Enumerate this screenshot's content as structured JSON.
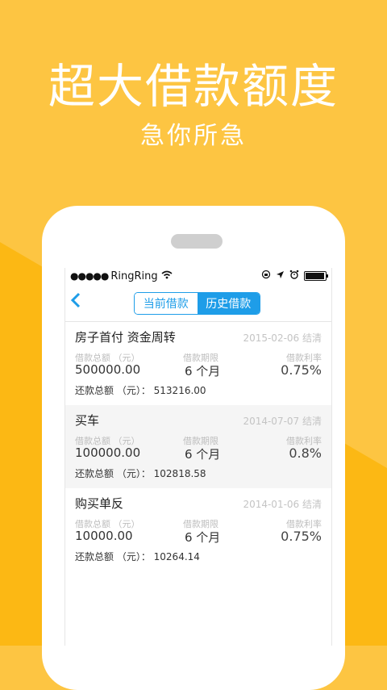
{
  "promo": {
    "headline": "超大借款额度",
    "subheadline": "急你所急"
  },
  "status_bar": {
    "signal": "●●●●●",
    "carrier": "RingRing",
    "battery_fraction": 0.9
  },
  "nav": {
    "tabs": [
      {
        "label": "当前借款",
        "active": false
      },
      {
        "label": "历史借款",
        "active": true
      }
    ]
  },
  "loans": [
    {
      "name": "房子首付 资金周转",
      "date_status": "2015-02-06 结清",
      "amount_label": "借款总额 （元）",
      "amount": "500000.00",
      "term_label": "借款期限",
      "term": "6 个月",
      "rate_label": "借款利率",
      "rate": "0.75%",
      "repay_label": "还款总额 （元）：",
      "repay": "513216.00"
    },
    {
      "name": "买车",
      "date_status": "2014-07-07 结清",
      "amount_label": "借款总额 （元）",
      "amount": "100000.00",
      "term_label": "借款期限",
      "term": "6 个月",
      "rate_label": "借款利率",
      "rate": "0.8%",
      "repay_label": "还款总额 （元）：",
      "repay": "102818.58"
    },
    {
      "name": "购买单反",
      "date_status": "2014-01-06 结清",
      "amount_label": "借款总额 （元）",
      "amount": "10000.00",
      "term_label": "借款期限",
      "term": "6 个月",
      "rate_label": "借款利率",
      "rate": "0.75%",
      "repay_label": "还款总额 （元）：",
      "repay": "10264.14"
    }
  ],
  "colors": {
    "background": "#FDC542",
    "background_shade": "#FCB814",
    "accent": "#1E9DE8"
  }
}
